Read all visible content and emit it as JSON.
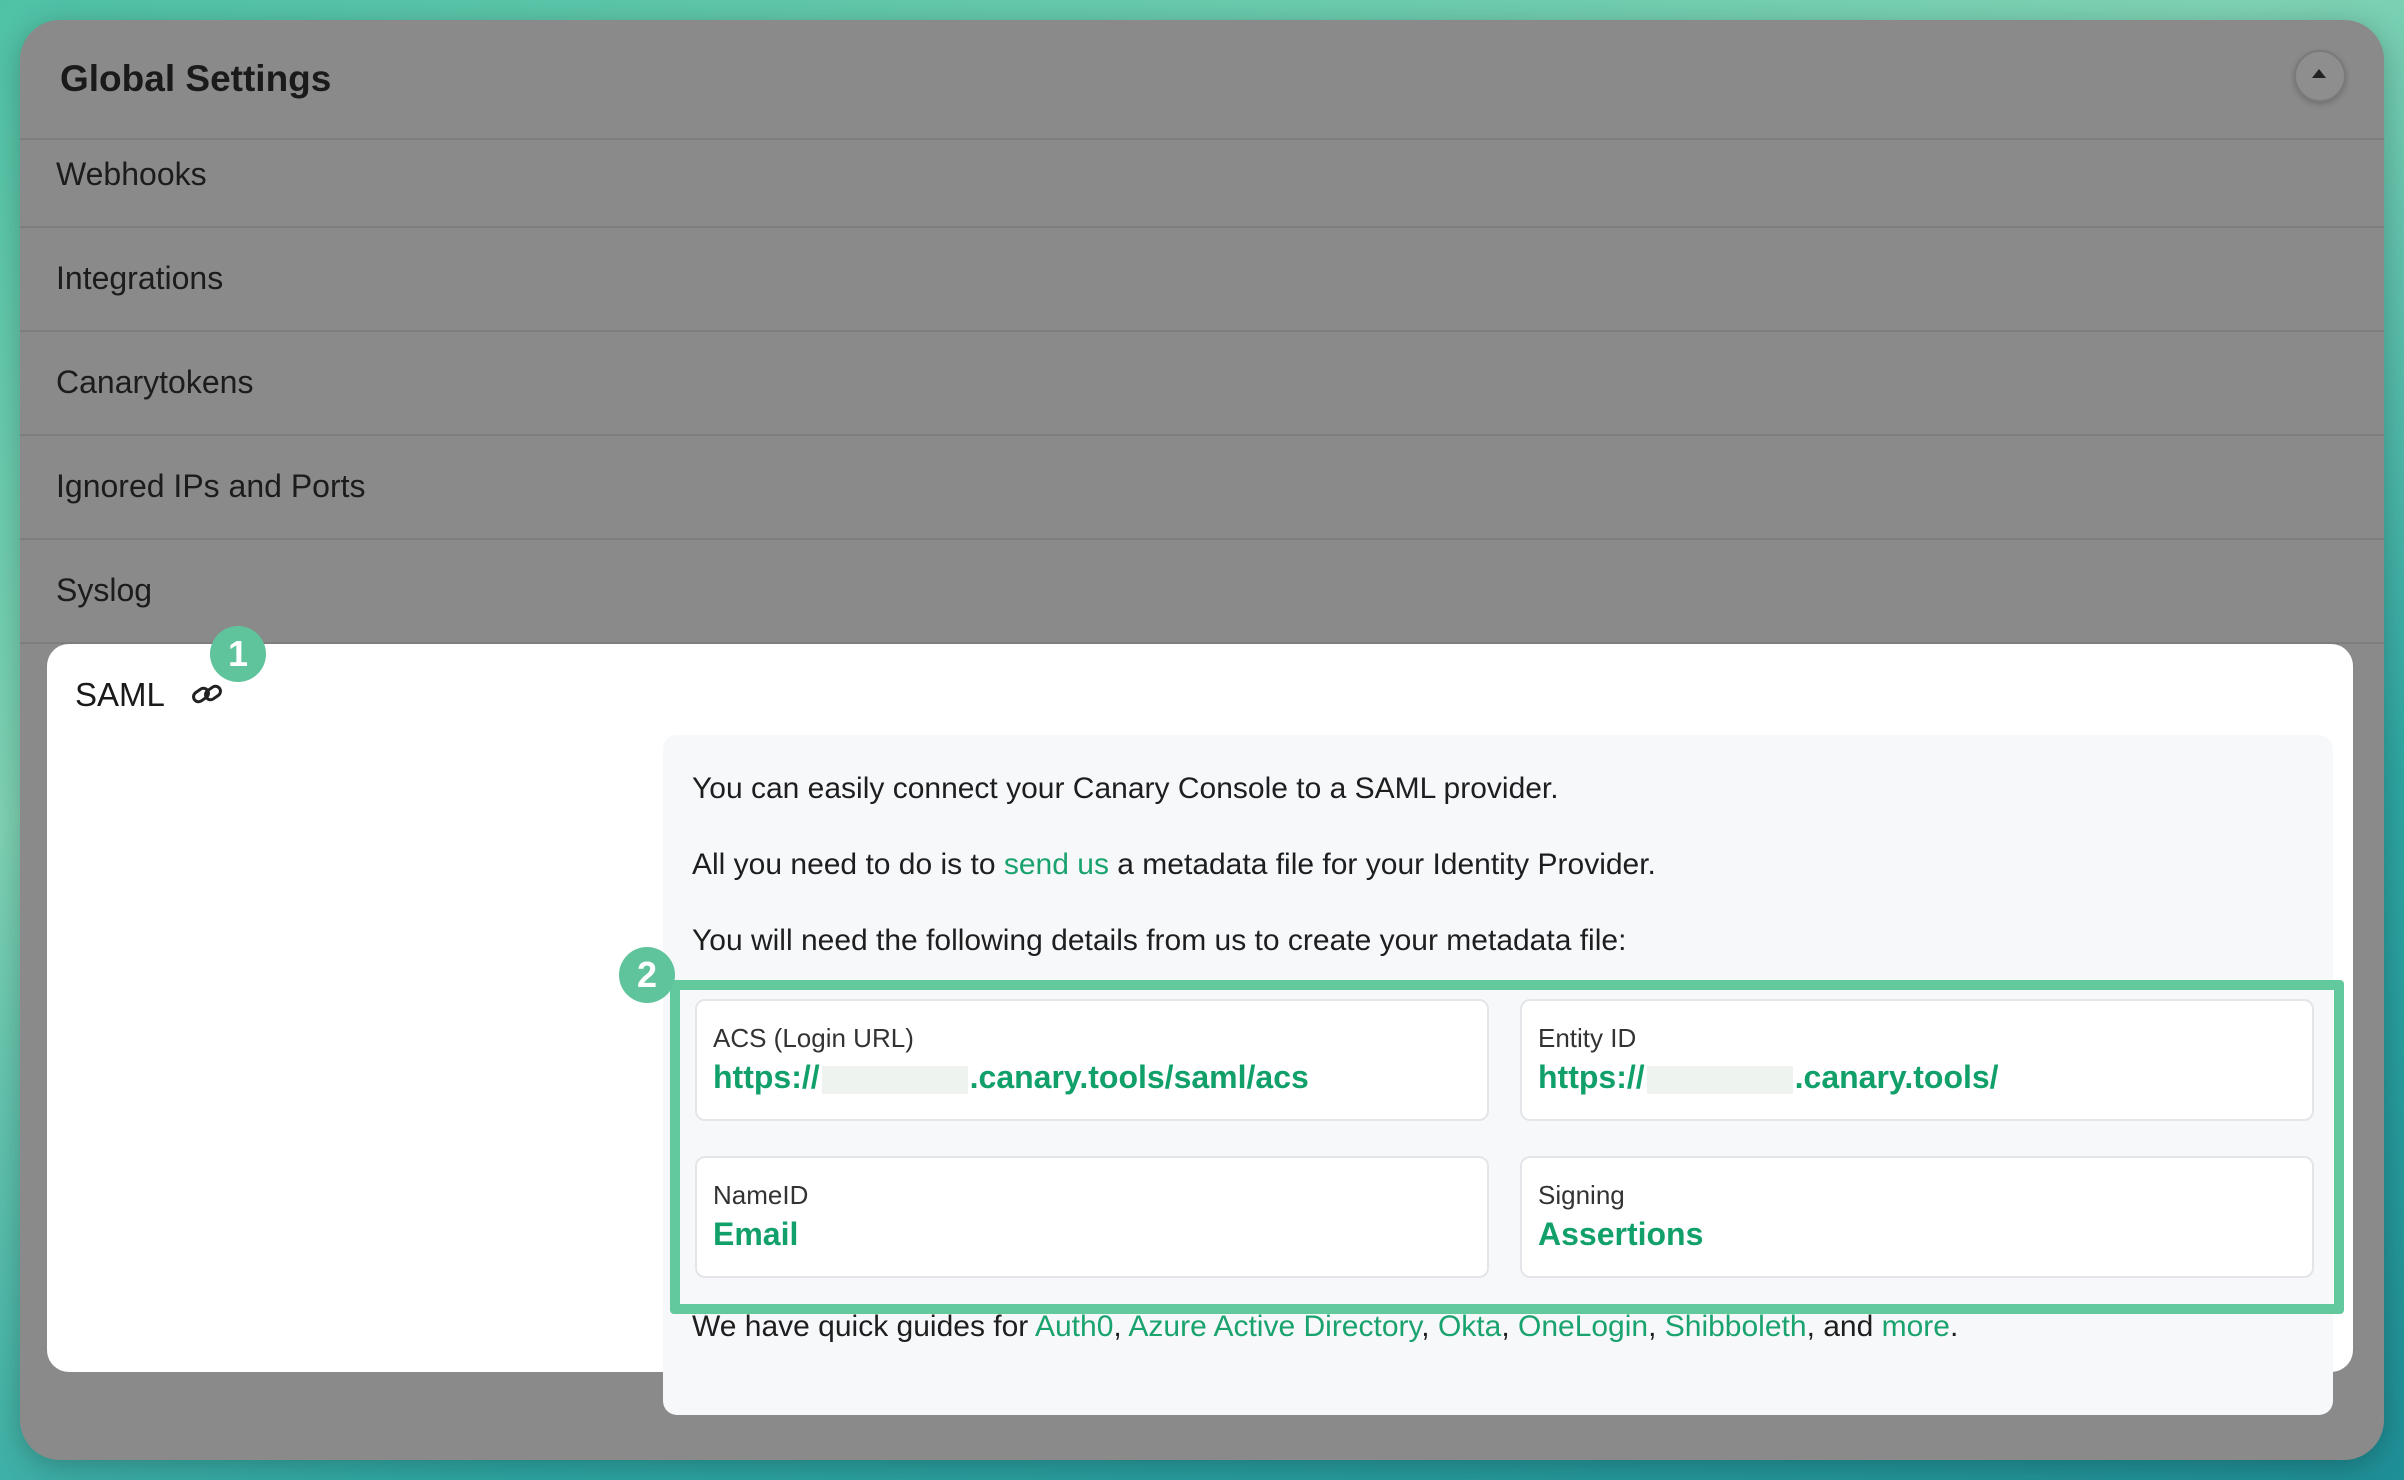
{
  "header": {
    "title": "Global Settings",
    "collapse_icon": "caret-up-icon"
  },
  "settings_rows": [
    "Webhooks",
    "Integrations",
    "Canarytokens",
    "Ignored IPs and Ports",
    "Syslog"
  ],
  "saml": {
    "title": "SAML",
    "link_icon": "link-icon",
    "badge_1": "1",
    "badge_2": "2",
    "intro": "You can easily connect your Canary Console to a SAML provider.",
    "send_prefix": "All you need to do is to ",
    "send_link": "send us",
    "send_suffix": " a metadata file for your Identity Provider.",
    "details_intro": "You will need the following details from us to create your metadata file:",
    "fields": [
      {
        "label": "ACS (Login URL)",
        "value_prefix": "https://",
        "value_suffix": ".canary.tools/saml/acs"
      },
      {
        "label": "Entity ID",
        "value_prefix": "https://",
        "value_suffix": ".canary.tools/"
      },
      {
        "label": "NameID",
        "value_prefix": "Email",
        "value_suffix": ""
      },
      {
        "label": "Signing",
        "value_prefix": "Assertions",
        "value_suffix": ""
      }
    ],
    "guides_prefix": "We have quick guides for ",
    "guides": [
      "Auth0",
      "Azure Active Directory",
      "Okta",
      "OneLogin",
      "Shibboleth"
    ],
    "guides_and": ", and ",
    "guides_more": "more",
    "guides_end": "."
  },
  "colors": {
    "accent": "#1aa36e",
    "highlight": "#62c99c",
    "overlay": "#8a8a8a"
  }
}
